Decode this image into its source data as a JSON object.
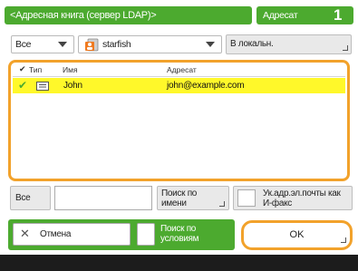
{
  "header": {
    "title": "<Адресная книга (сервер LDAP)>",
    "address_tab": "Адресат",
    "address_count": "1"
  },
  "controls": {
    "filter_value": "Все",
    "server_value": "starfish",
    "to_contacts_label": "В локальн."
  },
  "list": {
    "columns": {
      "type": "Тип",
      "name": "Имя",
      "address": "Адресат"
    },
    "rows": [
      {
        "checked": true,
        "type_icon": "email-icon",
        "name": "John",
        "address": "john@example.com"
      }
    ]
  },
  "search": {
    "all_label": "Все",
    "input_value": "",
    "by_name_label": "Поиск по имени",
    "ifax_label": "Ук.адр.эл.почты как И-факс"
  },
  "actions": {
    "cancel_label": "Отмена",
    "by_condition_label": "Поиск по условиям",
    "ok_label": "OK"
  },
  "colors": {
    "accent_green": "#4caa2f",
    "highlight_orange": "#f2a22b",
    "row_selected": "#fff82a",
    "footer": "#1c1c1c"
  }
}
